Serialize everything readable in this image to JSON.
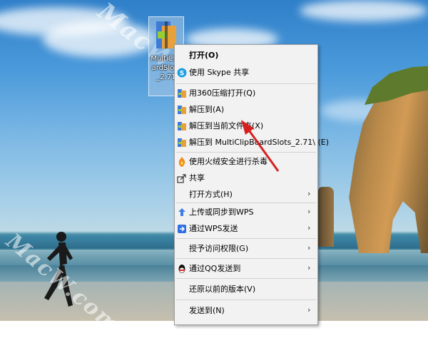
{
  "desktop": {
    "icon_label": "MultiClip\nardSlots\n_2.71",
    "watermark": "MacW.com"
  },
  "menu": {
    "items": [
      {
        "label": "打开(O)",
        "icon": "",
        "bold": true
      },
      {
        "label": "使用 Skype 共享",
        "icon": "skype-icon"
      },
      {
        "label": "用360压缩打开(Q)",
        "icon": "archive-icon"
      },
      {
        "label": "解压到(A)",
        "icon": "archive-icon"
      },
      {
        "label": "解压到当前文件夹(X)",
        "icon": "archive-icon"
      },
      {
        "label": "解压到 MultiClipBoardSlots_2.71\\ (E)",
        "icon": "archive-icon"
      },
      {
        "label": "使用火绒安全进行杀毒",
        "icon": "shield-icon"
      },
      {
        "label": "共享",
        "icon": "share-icon"
      },
      {
        "label": "打开方式(H)",
        "icon": "",
        "submenu": true
      },
      {
        "label": "上传或同步到WPS",
        "icon": "cloud-upload-icon",
        "submenu": true
      },
      {
        "label": "通过WPS发送",
        "icon": "wps-send-icon",
        "submenu": true
      },
      {
        "label": "授予访问权限(G)",
        "icon": "",
        "submenu": true
      },
      {
        "label": "通过QQ发送到",
        "icon": "qq-icon",
        "submenu": true
      },
      {
        "label": "还原以前的版本(V)",
        "icon": ""
      },
      {
        "label": "发送到(N)",
        "icon": "",
        "submenu": true
      }
    ],
    "submenu_arrow": "›"
  },
  "colors": {
    "menu_bg": "#f2f2f2",
    "annotation_arrow": "#d62020"
  }
}
